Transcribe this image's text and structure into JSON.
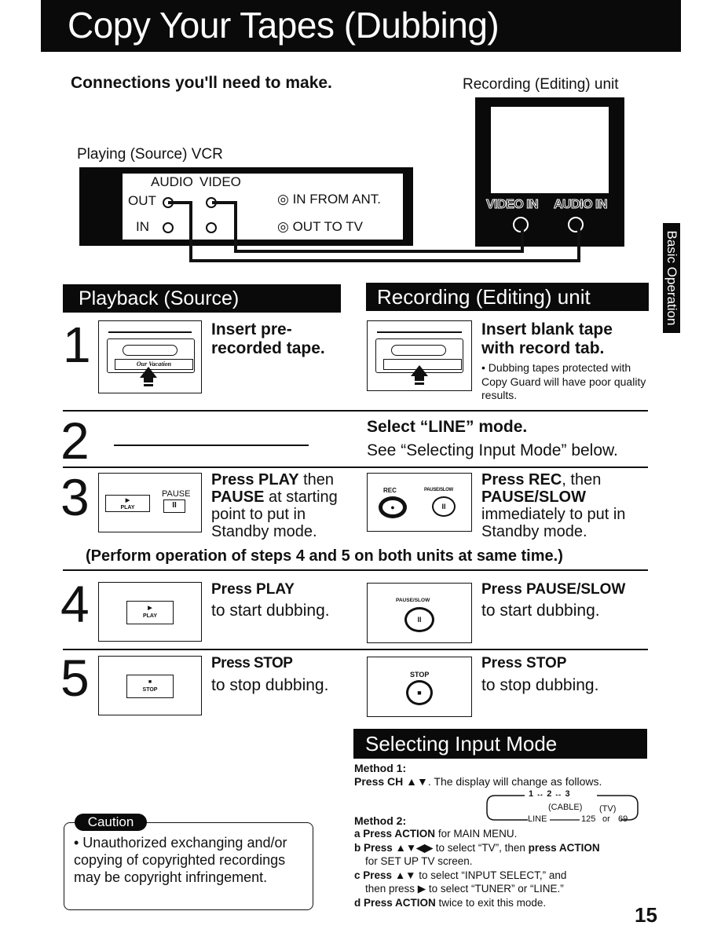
{
  "page": {
    "title": "Copy Your Tapes (Dubbing)",
    "page_number": "15",
    "side_tab": "Basic Operation"
  },
  "connections": {
    "heading": "Connections you'll need to make.",
    "recording_unit_label": "Recording (Editing) unit",
    "source_vcr_label": "Playing (Source) VCR",
    "vcr_panel": {
      "audio_label": "AUDIO",
      "video_label": "VIDEO",
      "out_label": "OUT",
      "in_label": "IN",
      "ant_in_label": "IN FROM ANT.",
      "ant_out_label": "OUT TO TV"
    },
    "tv_panel": {
      "video_in_label": "VIDEO IN",
      "audio_in_label": "AUDIO IN"
    }
  },
  "sections": {
    "playback": "Playback (Source)",
    "recording": "Recording (Editing) unit",
    "selecting": "Selecting Input Mode"
  },
  "steps": [
    {
      "number": "1",
      "left": {
        "line1": "Insert pre-",
        "line2": "recorded tape.",
        "tape_label": "Our Vacation"
      },
      "right": {
        "line1": "Insert blank tape",
        "line2": "with record tab.",
        "note": "• Dubbing tapes protected with Copy Guard will have poor quality results."
      }
    },
    {
      "number": "2",
      "right": {
        "bold": "Select “LINE” mode.",
        "plain": "See “Selecting Input Mode” below."
      }
    },
    {
      "number": "3",
      "left": {
        "bold1": "Press PLAY",
        "plain1": " then",
        "bold2": "PAUSE",
        "plain2": " at starting",
        "plain3": "point to put in",
        "plain4": "Standby mode.",
        "play_btn": "PLAY",
        "pause_btn_label": "PAUSE",
        "pause_glyph": "II"
      },
      "right": {
        "bold1": "Press REC",
        "plain1": ", then",
        "bold2": "PAUSE/SLOW",
        "plain3": "immediately to put in",
        "plain4": "Standby mode.",
        "rec_label": "REC",
        "pause_slow_label": "PAUSE/SLOW",
        "pause_glyph": "II"
      }
    },
    {
      "number": "4",
      "left": {
        "bold": "Press PLAY",
        "plain": "to start dubbing.",
        "btn": "PLAY"
      },
      "right": {
        "bold": "Press PAUSE/SLOW",
        "plain": "to start dubbing.",
        "btn_label": "PAUSE/SLOW",
        "glyph": "II"
      }
    },
    {
      "number": "5",
      "left": {
        "bold": "Press STOP",
        "plain": "to stop dubbing.",
        "btn": "STOP"
      },
      "right": {
        "bold": "Press STOP",
        "plain": "to stop dubbing.",
        "btn_label": "STOP"
      }
    }
  ],
  "simultaneous_note": "(Perform operation of steps 4 and 5 on both units at same time.)",
  "selecting_input": {
    "method1_title": "Method 1:",
    "method1_bold": "Press CH ▲▼",
    "method1_plain": ". The display will change as follows.",
    "cycle_top": "1 ↔ 2 ↔ 3",
    "cycle_cable": "(CABLE)",
    "cycle_tv": "(TV)",
    "cycle_line": "LINE",
    "cycle_125": "125",
    "cycle_or": "or",
    "cycle_69": "69",
    "method2_title": "Method 2:",
    "steps": [
      {
        "letter": "a",
        "bold": "Press ACTION",
        "plain": " for MAIN MENU."
      },
      {
        "letter": "b",
        "bold": "Press ▲▼◀▶",
        "plain": " to select “TV”, then ",
        "bold2": "press ACTION",
        "plain2": "for SET UP TV screen."
      },
      {
        "letter": "c",
        "bold": "Press ▲▼",
        "plain": " to select “INPUT SELECT,” and",
        "plain2": "then press ▶ to select “TUNER” or “LINE.”"
      },
      {
        "letter": "d",
        "bold": "Press ACTION",
        "plain": " twice to exit this mode."
      }
    ]
  },
  "caution": {
    "label": "Caution",
    "text": "• Unauthorized exchanging and/or copying of copyrighted recordings may be copyright infringement."
  }
}
